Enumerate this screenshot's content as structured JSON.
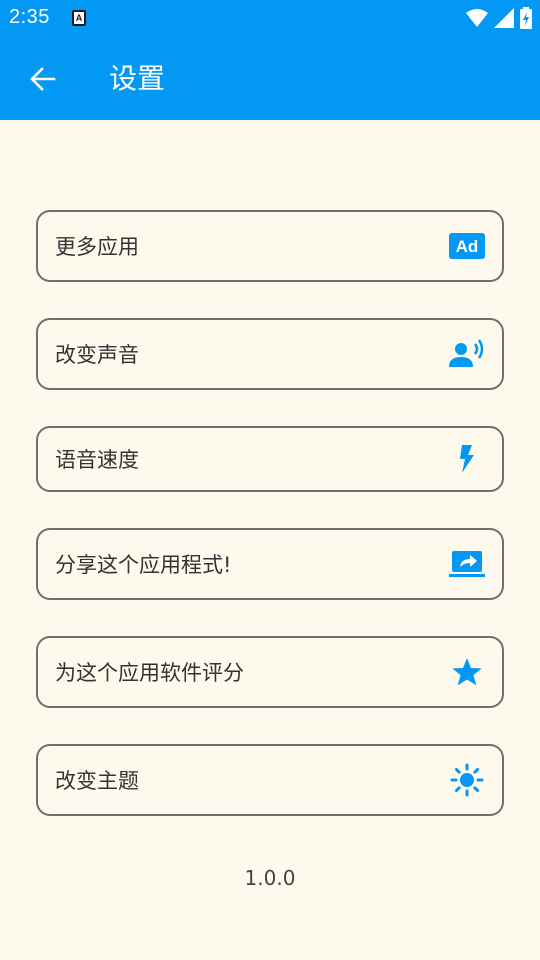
{
  "status_bar": {
    "time": "2:35",
    "notification_letter": "A"
  },
  "header": {
    "title": "设置",
    "back_icon": "arrow-left-icon"
  },
  "menu": [
    {
      "label": "更多应用",
      "icon": "ad-icon"
    },
    {
      "label": "改变声音",
      "icon": "voice-icon"
    },
    {
      "label": "语音速度",
      "icon": "bolt-icon"
    },
    {
      "label": "分享这个应用程式!",
      "icon": "share-screen-icon"
    },
    {
      "label": "为这个应用软件评分",
      "icon": "star-icon"
    },
    {
      "label": "改变主题",
      "icon": "brightness-icon"
    }
  ],
  "version": "1.0.0",
  "colors": {
    "accent": "#0398f3",
    "background": "#fef9ed",
    "border": "#6f6f6f"
  }
}
